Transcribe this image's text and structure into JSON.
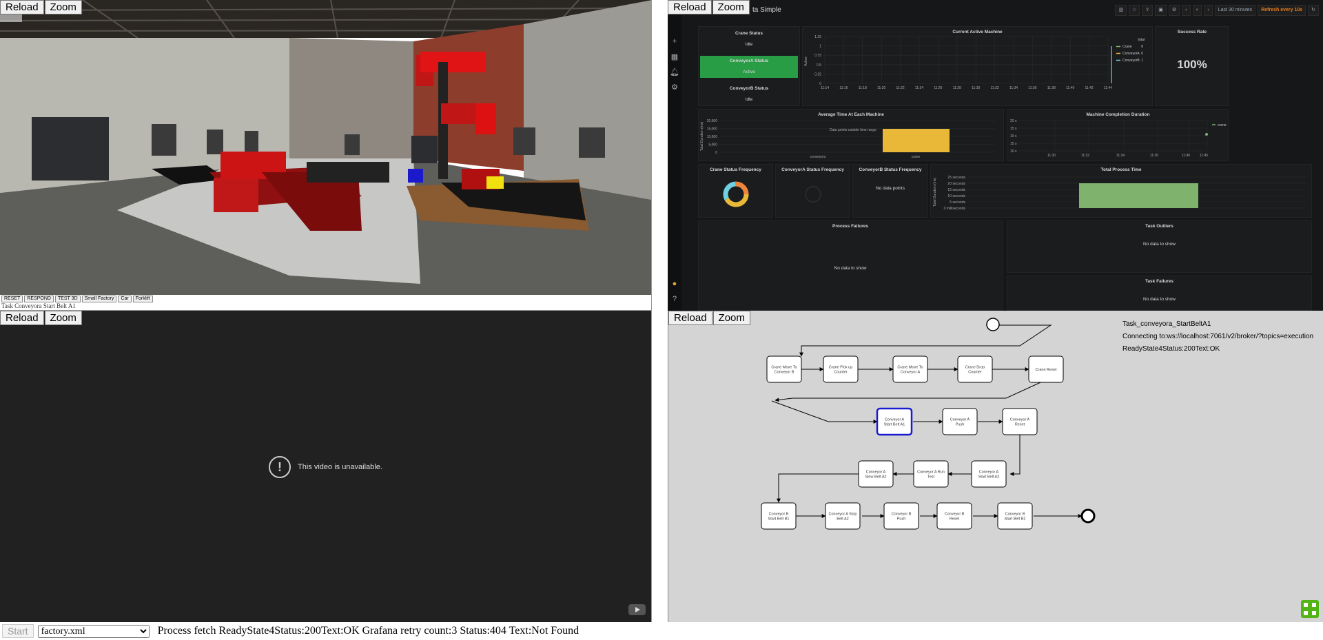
{
  "controls": {
    "reload": "Reload",
    "zoom": "Zoom"
  },
  "simulation": {
    "buttons": [
      "RESET",
      "RESPOND",
      "TEST 3D",
      "Small Factory",
      "Car",
      "Forklift"
    ],
    "status": "Task Conveyora Start Belt A1"
  },
  "grafana": {
    "dashboard_title": "ta Simple",
    "time_range": "Last 30 minutes",
    "refresh": "Refresh every 10s",
    "panels": {
      "crane_status": {
        "title": "Crane Status",
        "value": "Idle"
      },
      "conveyor_a_status": {
        "title": "ConveyorA Status",
        "value": "Active",
        "color": "#299c46"
      },
      "conveyor_b_status": {
        "title": "ConveyorB Status",
        "value": "Idle"
      },
      "current_active": {
        "title": "Current Active Machine",
        "ylabel": "Active",
        "y_ticks": [
          "1.25",
          "1",
          "0.75",
          "0.5",
          "0.25",
          "0"
        ],
        "x_ticks": [
          "11:14",
          "11:16",
          "11:18",
          "11:20",
          "11:22",
          "11:24",
          "11:26",
          "11:28",
          "11:30",
          "11:32",
          "11:34",
          "11:36",
          "11:38",
          "11:40",
          "11:42",
          "11:44"
        ],
        "legend_header": "total",
        "legend": [
          {
            "name": "Crane",
            "value": "0",
            "color": "#7eb26d"
          },
          {
            "name": "ConveyorA",
            "value": "0",
            "color": "#eab839"
          },
          {
            "name": "ConveyorB",
            "value": "1",
            "color": "#6ed0e0"
          }
        ]
      },
      "success_rate": {
        "title": "Success Rate",
        "value": "100%"
      },
      "avg_time": {
        "title": "Average Time At Each Machine",
        "ylabel": "Total Duration (ms)",
        "y_ticks": [
          "20,000",
          "15,000",
          "10,000",
          "5,000",
          "0"
        ],
        "categories": [
          "conveyors",
          "crane"
        ],
        "annotation": "Data points outside time range",
        "bar_color": "#eab839"
      },
      "completion": {
        "title": "Machine Completion Duration",
        "y_ticks": [
          "20 s",
          "15 s",
          "10 s",
          "15 s",
          "10 s"
        ],
        "x_ticks": [
          "11:30",
          "11:32",
          "11:34",
          "11:36",
          "11:40",
          "11:45"
        ],
        "legend": "crane"
      },
      "crane_freq": {
        "title": "Crane Status Frequency"
      },
      "conva_freq": {
        "title": "ConveyorA Status Frequency"
      },
      "convb_freq": {
        "title": "ConveyorB Status Frequency",
        "nodata": "No data points"
      },
      "total_time": {
        "title": "Total Process Time",
        "ylabel": "Total Duration (ms)",
        "y_ticks": [
          "25 seconds",
          "20 seconds",
          "15 seconds",
          "10 seconds",
          "5 seconds",
          "0 milliseconds"
        ],
        "bar_color": "#7eb26d"
      },
      "failures": {
        "title": "Process Failures",
        "nodata": "No data to show"
      },
      "outliers": {
        "title": "Task Outliers",
        "nodata": "No data to show"
      },
      "task_failures": {
        "title": "Task Failures",
        "nodata": "No data to show"
      }
    }
  },
  "video": {
    "message": "This video is unavailable."
  },
  "bottom": {
    "start": "Start",
    "file_select": "factory.xml",
    "message": "Process fetch ReadyState4Status:200Text:OK    Grafana retry count:3 Status:404 Text:Not Found"
  },
  "flow": {
    "task": "Task_conveyora_StartBeltA1",
    "connecting": "Connecting to:ws://localhost:7061/v2/broker/?topics=execution",
    "status": "ReadyState4Status:200Text:OK",
    "nodes": [
      [
        "Crane Move To",
        "Conveyor B"
      ],
      [
        "Crane Pick up",
        "Counter"
      ],
      [
        "Crane Move To",
        "Conveyor A"
      ],
      [
        "Crane Drop",
        "Counter"
      ],
      [
        "Crane Reset"
      ],
      [
        "Conveyor A",
        "Start Belt A1"
      ],
      [
        "Conveyor A",
        "Push"
      ],
      [
        "Conveyor A",
        "Reset"
      ],
      [
        "Conveyor A",
        "Start Belt A2"
      ],
      [
        "Conveyor A Run",
        "Test"
      ],
      [
        "Conveyor A",
        "Slow Belt A2"
      ],
      [
        "Conveyor B",
        "Start Belt B1"
      ],
      [
        "Conveyor A Stop",
        "Belt A2"
      ],
      [
        "Conveyor B",
        "Push"
      ],
      [
        "Conveyor B",
        "Reset"
      ],
      [
        "Conveyor B",
        "Start Belt B2"
      ]
    ],
    "active_node": 5
  }
}
